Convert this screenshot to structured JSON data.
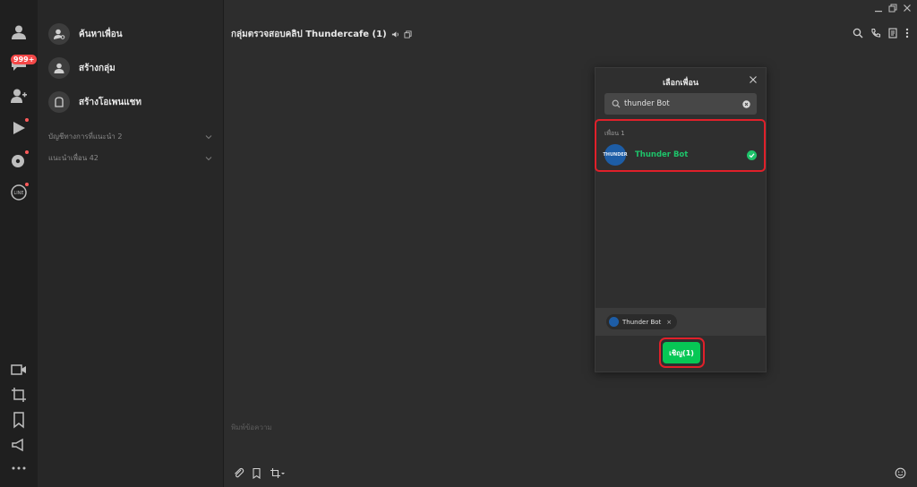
{
  "rail": {
    "badge": "999+",
    "items": [
      {
        "name": "friends-icon"
      },
      {
        "name": "chats-icon"
      },
      {
        "name": "add-friend-icon"
      },
      {
        "name": "voom-icon"
      },
      {
        "name": "openchat-icon"
      },
      {
        "name": "line-icon",
        "label": "LINE"
      }
    ],
    "bottom": [
      "video-call-icon",
      "crop-icon",
      "bookmark-icon",
      "announce-icon",
      "more-icon"
    ]
  },
  "sidebar": {
    "menu": [
      {
        "label": "ค้นหาเพื่อน"
      },
      {
        "label": "สร้างกลุ่ม"
      },
      {
        "label": "สร้างโอเพนแชท"
      }
    ],
    "sections": [
      {
        "label": "บัญชีทางการที่แนะนำ 2"
      },
      {
        "label": "แนะนำเพื่อน 42"
      }
    ]
  },
  "header": {
    "title": "กลุ่มตรวจสอบคลิป Thundercafe (1)"
  },
  "composer": {
    "placeholder": "พิมพ์ข้อความ"
  },
  "modal": {
    "title": "เลือกเพื่อน",
    "search_value": "thunder Bot",
    "count_label": "เพื่อน  1",
    "friend": {
      "name": "Thunder Bot",
      "avatar_text": "THUNDER"
    },
    "chip_label": "Thunder Bot",
    "chip_remove": "×",
    "invite_label": "เชิญ(1)"
  },
  "colors": {
    "accent_green": "#07c755",
    "highlight_red": "#e0202a",
    "badge_red": "#f44848"
  }
}
